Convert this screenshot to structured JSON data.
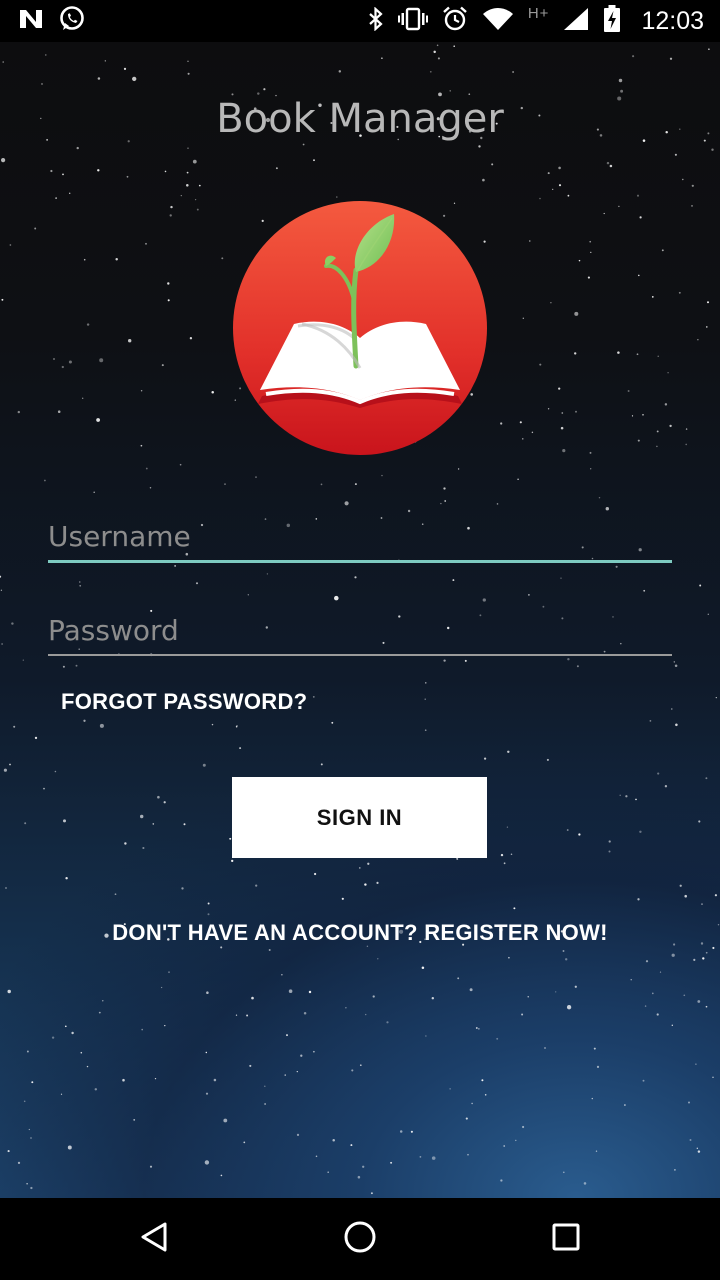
{
  "status_bar": {
    "time": "12:03",
    "network_label": "H+",
    "icons": [
      "n-notification-icon",
      "whatsapp-icon",
      "bluetooth-icon",
      "vibrate-icon",
      "alarm-icon",
      "wifi-icon",
      "signal-icon",
      "battery-charging-icon"
    ]
  },
  "app": {
    "title": "Book Manager",
    "logo_icon": "book-sprout-logo"
  },
  "login_form": {
    "username_placeholder": "Username",
    "username_value": "",
    "password_placeholder": "Password",
    "password_value": "",
    "forgot_password_label": "FORGOT PASSWORD?",
    "sign_in_label": "SIGN IN",
    "register_label": "DON'T HAVE AN ACCOUNT? REGISTER NOW!"
  },
  "nav_bar": {
    "buttons": [
      "back-icon",
      "home-icon",
      "recents-icon"
    ]
  },
  "colors": {
    "accent_underline": "#7ecbc1",
    "logo_red": "#e8332a",
    "button_bg": "#ffffff"
  }
}
